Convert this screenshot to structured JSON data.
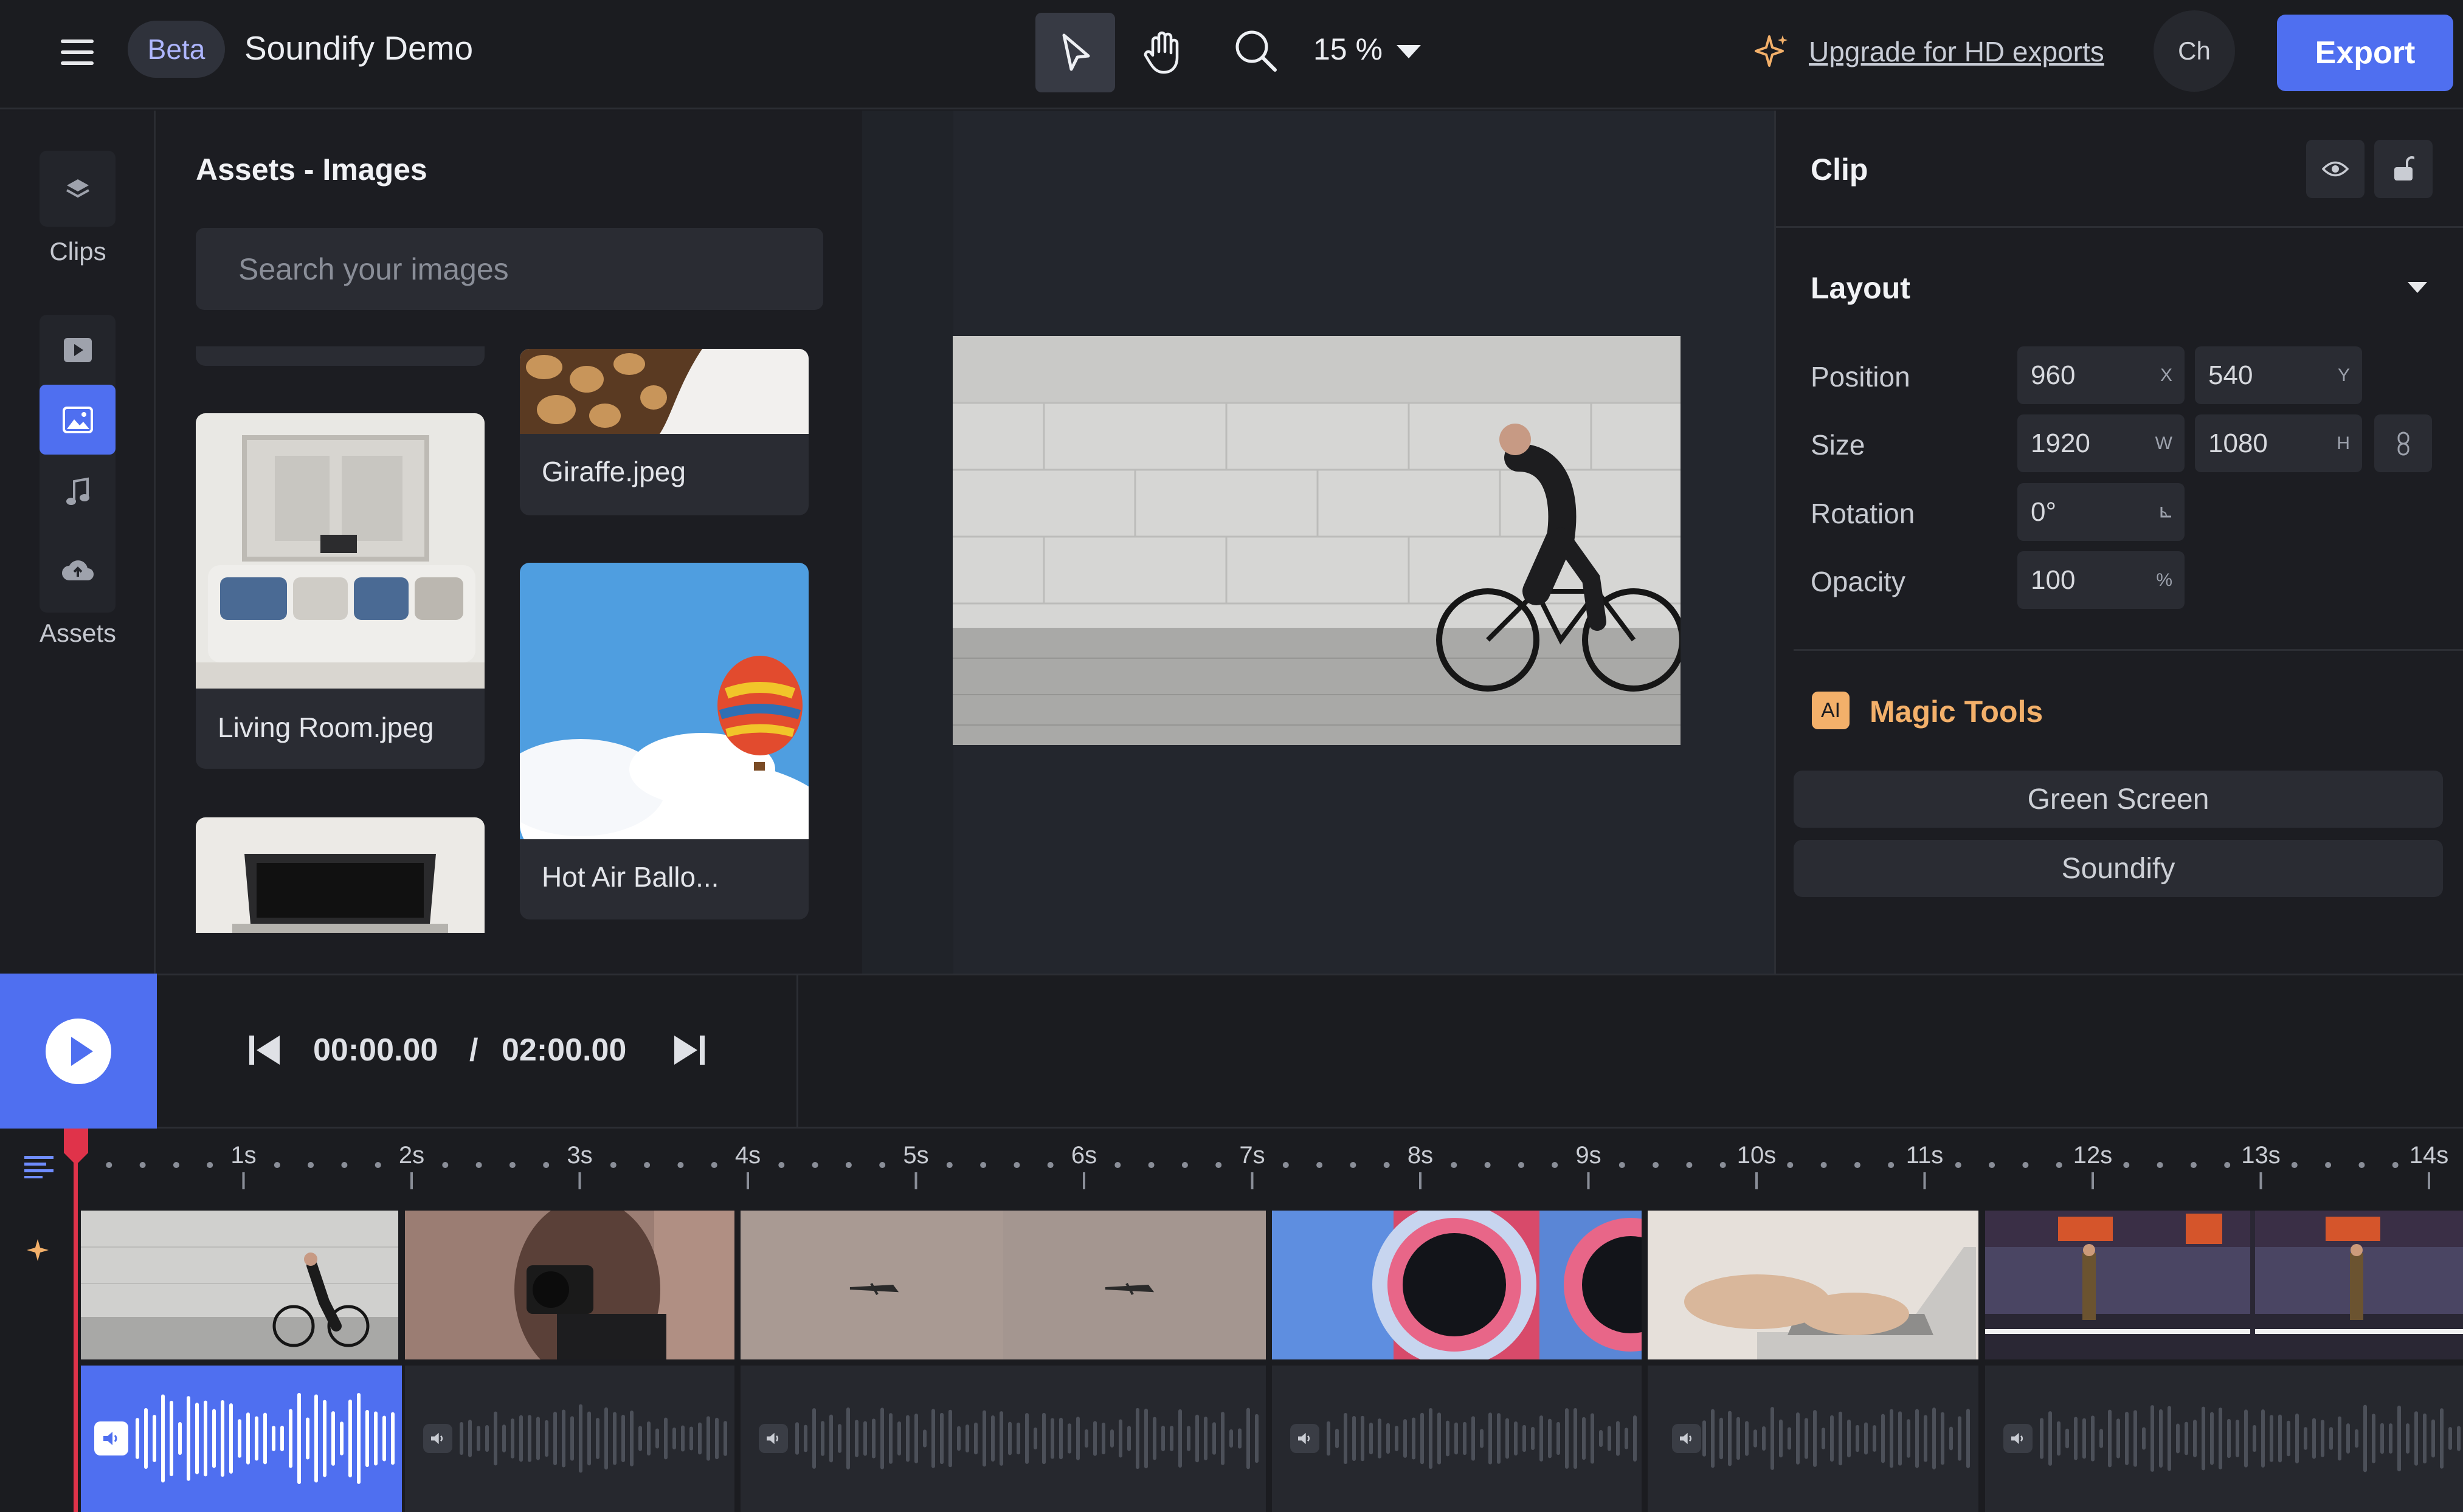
{
  "app": {
    "badge": "Beta",
    "title": "Soundify Demo",
    "zoom": "15 %",
    "upgrade_link": "Upgrade for HD exports",
    "avatar_initials": "Ch",
    "export_label": "Export"
  },
  "rail": {
    "clips_label": "Clips",
    "assets_label": "Assets",
    "active_item": "images"
  },
  "assets": {
    "title": "Assets - Images",
    "search_placeholder": "Search your images",
    "images": [
      {
        "name": "Living Room.jpeg"
      },
      {
        "name": "Giraffe.jpeg"
      },
      {
        "name": "Hot Air Ballo..."
      }
    ]
  },
  "clip_panel": {
    "title": "Clip",
    "layout_section": "Layout",
    "position_label": "Position",
    "position_x": "960",
    "position_y": "540",
    "x_unit": "X",
    "y_unit": "Y",
    "size_label": "Size",
    "size_w": "1920",
    "size_h": "1080",
    "w_unit": "W",
    "h_unit": "H",
    "rotation_label": "Rotation",
    "rotation_value": "0°",
    "opacity_label": "Opacity",
    "opacity_value": "100",
    "opacity_unit": "%",
    "magic_badge": "AI",
    "magic_title": "Magic Tools",
    "magic_buttons": [
      "Green Screen",
      "Soundify"
    ]
  },
  "transport": {
    "current_time": "00:00.00",
    "separator": "/",
    "total_time": "02:00.00"
  },
  "timeline": {
    "ticks": [
      "1s",
      "2s",
      "3s",
      "4s",
      "5s",
      "6s",
      "7s",
      "8s",
      "9s",
      "10s",
      "11s",
      "12s",
      "13s",
      "14s"
    ]
  },
  "colors": {
    "accent": "#4f6ff0",
    "magic": "#f3b06a",
    "playhead": "#e0334a"
  }
}
